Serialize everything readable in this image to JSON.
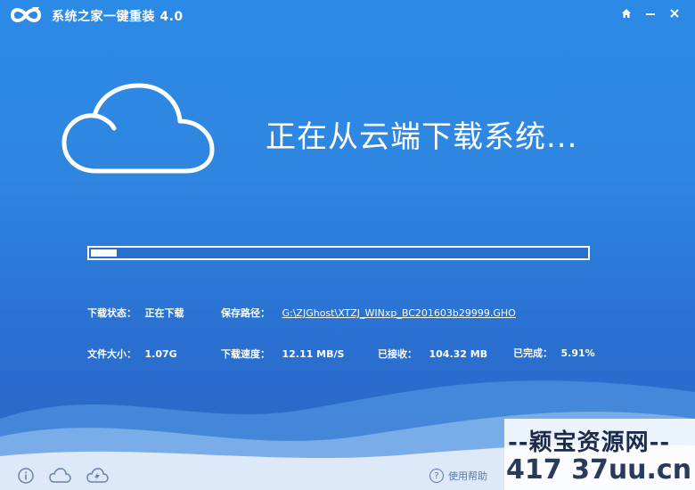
{
  "app": {
    "title": "系统之家一键重装  4.0"
  },
  "icons": {
    "logo": "infinity-logo-icon",
    "home": "home-icon",
    "minimize": "minimize-icon",
    "close": "close-icon",
    "cloud": "cloud-icon",
    "info": "info-icon",
    "footer_cloud": "cloud-outline-icon",
    "flash": "flash-cloud-icon",
    "help": "help-icon"
  },
  "main": {
    "headline": "正在从云端下载系统..."
  },
  "progress": {
    "percent": 5.91
  },
  "status": {
    "download_state_label": "下载状态：",
    "download_state_value": "正在下载",
    "save_path_label": "保存路径：",
    "save_path_value": "G:\\ZJGhost\\XTZJ_WINxp_BC201603b29999.GHO",
    "file_size_label": "文件大小：",
    "file_size_value": "1.07G",
    "speed_label": "下载速度：",
    "speed_value": "12.11 MB/S",
    "received_label": "已接收：",
    "received_value": "104.32 MB",
    "completed_label": "已完成：",
    "completed_value": "5.91%"
  },
  "footer": {
    "help_label": "使用帮助",
    "help_glyph": "?"
  },
  "watermark": {
    "line1": "--颖宝资源网--",
    "line2": "417 37uu.cn"
  },
  "colors": {
    "background": "#2b8ae6",
    "text": "#ffffff"
  }
}
